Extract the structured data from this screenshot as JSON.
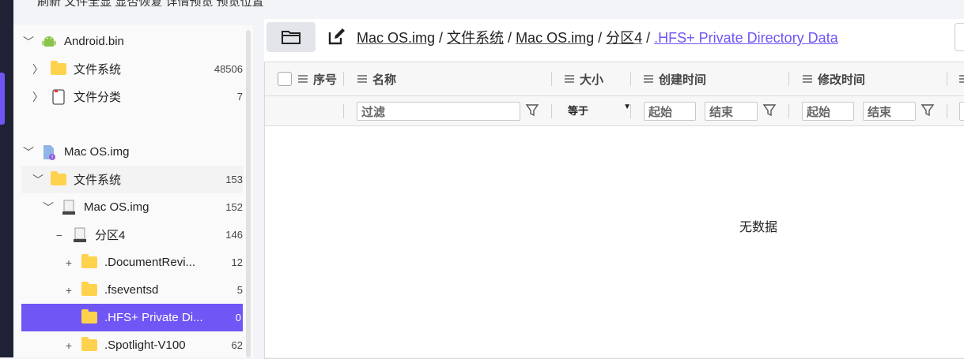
{
  "top_toolbar": {
    "text": "刷新   文件全显  显否恢复  详情预览  预览位置"
  },
  "tree": {
    "items": [
      {
        "label": "Android.bin",
        "count": "",
        "toggle": "chevron-down"
      },
      {
        "label": "文件系统",
        "count": "48506",
        "toggle": "chevron-right"
      },
      {
        "label": "文件分类",
        "count": "7",
        "toggle": "chevron-right"
      },
      {
        "label": "Mac OS.img",
        "count": "",
        "toggle": "chevron-down"
      },
      {
        "label": "文件系统",
        "count": "153",
        "toggle": "chevron-down"
      },
      {
        "label": "Mac OS.img",
        "count": "152",
        "toggle": "chevron-down"
      },
      {
        "label": "分区4",
        "count": "146",
        "toggle": "minus"
      },
      {
        "label": ".DocumentRevi...",
        "count": "12",
        "toggle": "plus"
      },
      {
        "label": ".fseventsd",
        "count": "5",
        "toggle": "plus"
      },
      {
        "label": ".HFS+ Private Di...",
        "count": "0",
        "toggle": ""
      },
      {
        "label": ".Spotlight-V100",
        "count": "62",
        "toggle": "plus"
      }
    ]
  },
  "path": {
    "segments": [
      "Mac OS.img",
      "文件系统",
      "Mac OS.img",
      "分区4",
      ".HFS+ Private Directory Data"
    ],
    "separator": "/"
  },
  "table": {
    "columns": [
      "序号",
      "名称",
      "大小",
      "创建时间",
      "修改时间"
    ],
    "filter": {
      "name_placeholder": "过滤",
      "size_operator": "等于",
      "created_start": "起始",
      "created_end": "结束",
      "modified_start": "起始",
      "modified_end": "结束"
    },
    "empty_text": "无数据"
  },
  "colors": {
    "accent": "#6f55f5",
    "folder": "#ffd24d",
    "rail": "#1f2235"
  }
}
